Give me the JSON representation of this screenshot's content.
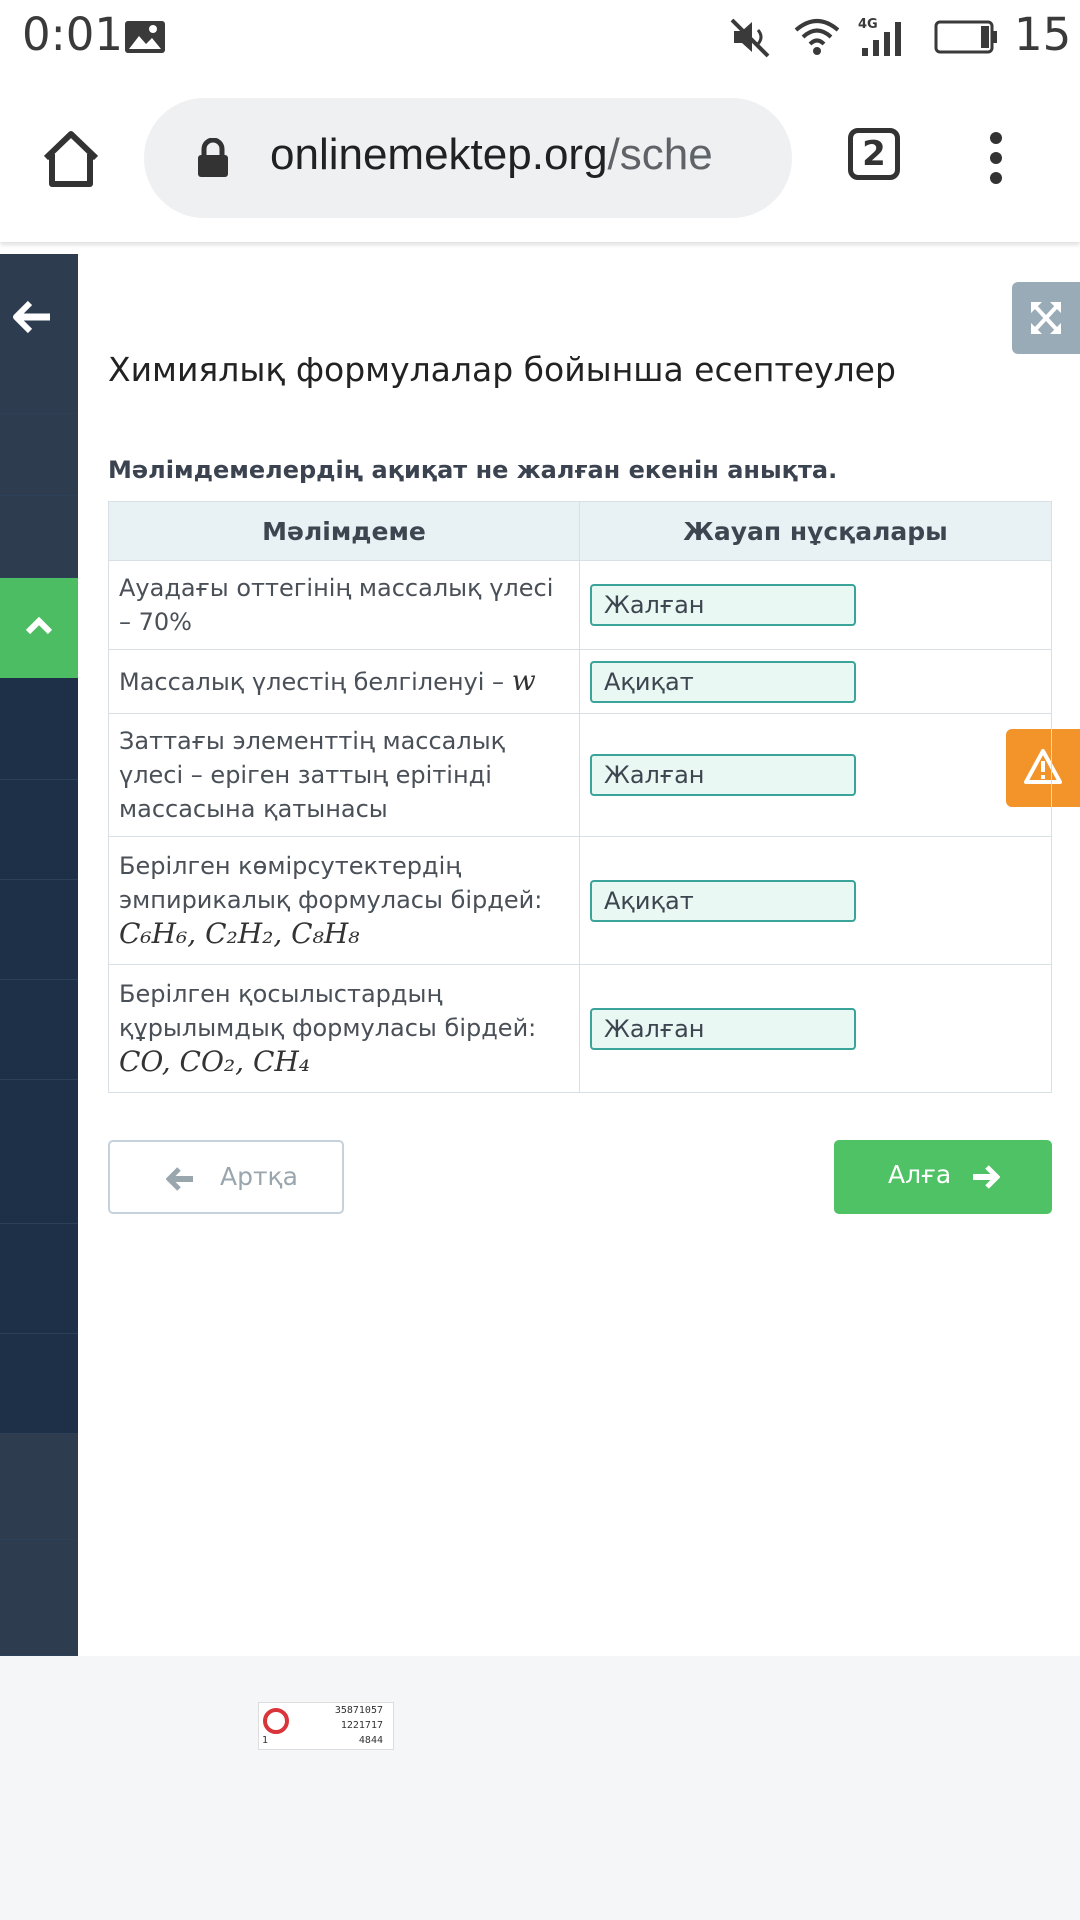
{
  "status_bar": {
    "time": "0:01",
    "battery": "15",
    "network": "4G"
  },
  "browser": {
    "url_domain": "onlinemektep.org",
    "url_path": "/sche",
    "tab_count": "2"
  },
  "page": {
    "title": "Химиялық формулалар бойынша есептеулер",
    "instruction": "Мәлімдемелердің ақиқат не жалған екенін анықта.",
    "table": {
      "headers": [
        "Мәлімдеме",
        "Жауап нұсқалары"
      ],
      "rows": [
        {
          "statement": "Ауадағы оттегінің массалық үлесі – 70%",
          "formula": "",
          "answer": "Жалған"
        },
        {
          "statement": "Массалық үлестің белгіленуі –",
          "formula": "w",
          "answer": "Ақиқат"
        },
        {
          "statement": "Заттағы элементтің массалық үлесі – еріген заттың ерітінді массасына қатынасы",
          "formula": "",
          "answer": "Жалған"
        },
        {
          "statement": "Берілген көмірсутектердің эмпирикалық формуласы бірдей:",
          "formula": "C₆H₆, C₂H₂, C₈H₈",
          "answer": "Ақиқат"
        },
        {
          "statement": "Берілген қосылыстардың құрылымдық формуласы бірдей:",
          "formula": "CO, CO₂, CH₄",
          "answer": "Жалған"
        }
      ]
    },
    "buttons": {
      "back": "Артқа",
      "next": "Алға"
    }
  },
  "stamp": {
    "line1": "35871057",
    "line2": "1221717",
    "line3": "4844",
    "corner": "1"
  },
  "colors": {
    "sidebar": "#1e3048",
    "accent_green": "#4ec264",
    "warning": "#f3942a",
    "answer_border": "#3aa39a"
  }
}
